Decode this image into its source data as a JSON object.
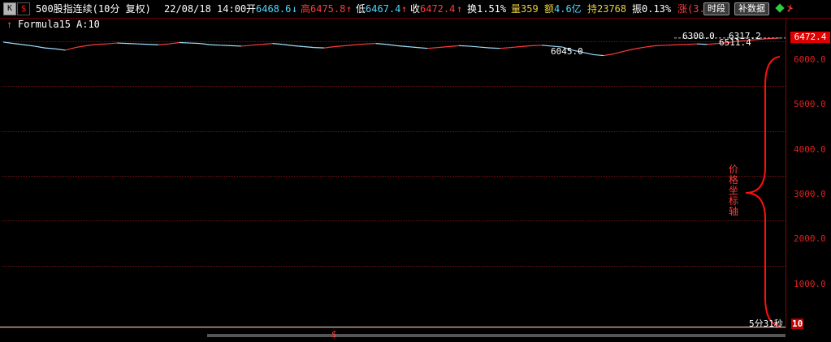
{
  "header": {
    "k_button": "K",
    "s_button": "$",
    "title": "500股指连续(10分 复权)",
    "datetime": "22/08/18 14:00",
    "open_label": "开",
    "open_value": "6468.6",
    "high_label": "高",
    "high_value": "6475.8",
    "low_label": "低",
    "low_value": "6467.4",
    "close_label": "收",
    "close_value": "6472.4",
    "turnover_label": "换",
    "turnover_value": "1.51%",
    "volume_label": "量",
    "volume_value": "359",
    "amount_label": "额",
    "amount_value": "4.6亿",
    "hold_label": "持",
    "hold_value": "23768",
    "amplitude_label": "振",
    "amplitude_value": "0.13%",
    "change_label": "涨",
    "change_value": "(3.",
    "time_button": "时段",
    "fill_button": "补数据",
    "arrow_down": "↓",
    "arrow_up": "↑"
  },
  "formula": {
    "label": "Formula15",
    "value": "A:10"
  },
  "chart": {
    "current_price": "6472.4",
    "annotations": [
      "6300.0",
      "6317.2",
      "6511.4",
      "6045.0"
    ],
    "countdown": "5分31秒",
    "bottom_value": "10",
    "brace_label": "价格坐标轴",
    "y_ticks": [
      "6000.0",
      "5000.0",
      "4000.0",
      "3000.0",
      "2000.0",
      "1000.0"
    ]
  },
  "chart_data": {
    "type": "line",
    "title": "",
    "xlabel": "",
    "ylabel": "",
    "ylim": [
      0,
      6500
    ],
    "y_ticks": [
      1000,
      2000,
      3000,
      4000,
      5000,
      6000
    ],
    "series": [
      {
        "values": [
          6380,
          6350,
          6320,
          6290,
          6250,
          6230,
          6200,
          6260,
          6300,
          6330,
          6340,
          6360,
          6350,
          6340,
          6330,
          6320,
          6340,
          6370,
          6360,
          6350,
          6320,
          6310,
          6300,
          6290,
          6310,
          6330,
          6350,
          6330,
          6300,
          6280,
          6260,
          6250,
          6280,
          6300,
          6320,
          6340,
          6350,
          6330,
          6300,
          6280,
          6260,
          6240,
          6260,
          6280,
          6300,
          6290,
          6270,
          6250,
          6240,
          6260,
          6280,
          6300,
          6310,
          6290,
          6270,
          6200,
          6150,
          6100,
          6080,
          6120,
          6180,
          6230,
          6270,
          6300,
          6310,
          6320,
          6330,
          6340,
          6330,
          6350,
          6370,
          6400,
          6420,
          6440,
          6460,
          6472
        ]
      }
    ]
  },
  "colors": {
    "up": "#ff3b3b",
    "down": "#22cc22",
    "grid": "#7a1010",
    "axis_text": "#e02020",
    "title_text": "#d0d0d0",
    "cyan": "#4fd8ff",
    "yellow": "#e8d040"
  }
}
